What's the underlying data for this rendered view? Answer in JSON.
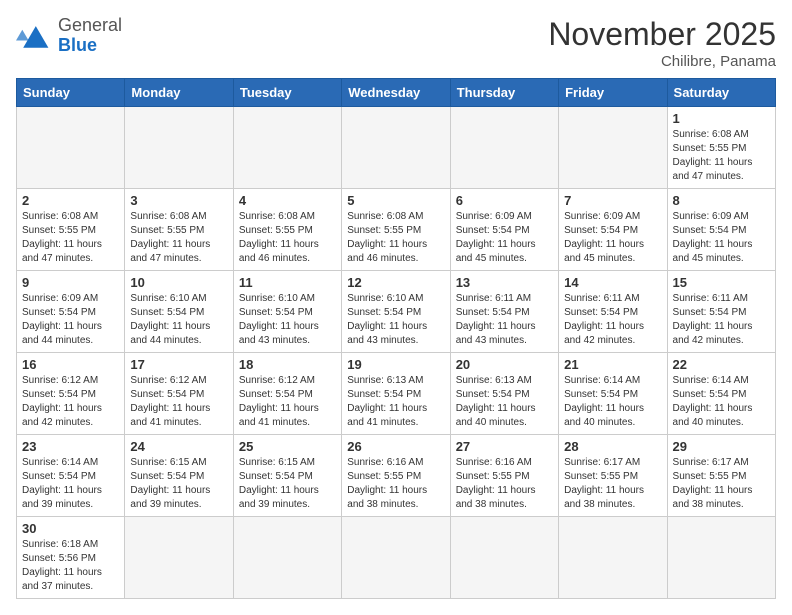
{
  "header": {
    "logo_general": "General",
    "logo_blue": "Blue",
    "month_title": "November 2025",
    "location": "Chilibre, Panama"
  },
  "weekdays": [
    "Sunday",
    "Monday",
    "Tuesday",
    "Wednesday",
    "Thursday",
    "Friday",
    "Saturday"
  ],
  "days": [
    {
      "date": null,
      "empty": true
    },
    {
      "date": null,
      "empty": true
    },
    {
      "date": null,
      "empty": true
    },
    {
      "date": null,
      "empty": true
    },
    {
      "date": null,
      "empty": true
    },
    {
      "date": null,
      "empty": true
    },
    {
      "date": "1",
      "sunrise": "6:08 AM",
      "sunset": "5:55 PM",
      "daylight": "11 hours and 47 minutes."
    },
    {
      "date": "2",
      "sunrise": "6:08 AM",
      "sunset": "5:55 PM",
      "daylight": "11 hours and 47 minutes."
    },
    {
      "date": "3",
      "sunrise": "6:08 AM",
      "sunset": "5:55 PM",
      "daylight": "11 hours and 47 minutes."
    },
    {
      "date": "4",
      "sunrise": "6:08 AM",
      "sunset": "5:55 PM",
      "daylight": "11 hours and 46 minutes."
    },
    {
      "date": "5",
      "sunrise": "6:08 AM",
      "sunset": "5:55 PM",
      "daylight": "11 hours and 46 minutes."
    },
    {
      "date": "6",
      "sunrise": "6:09 AM",
      "sunset": "5:54 PM",
      "daylight": "11 hours and 45 minutes."
    },
    {
      "date": "7",
      "sunrise": "6:09 AM",
      "sunset": "5:54 PM",
      "daylight": "11 hours and 45 minutes."
    },
    {
      "date": "8",
      "sunrise": "6:09 AM",
      "sunset": "5:54 PM",
      "daylight": "11 hours and 45 minutes."
    },
    {
      "date": "9",
      "sunrise": "6:09 AM",
      "sunset": "5:54 PM",
      "daylight": "11 hours and 44 minutes."
    },
    {
      "date": "10",
      "sunrise": "6:10 AM",
      "sunset": "5:54 PM",
      "daylight": "11 hours and 44 minutes."
    },
    {
      "date": "11",
      "sunrise": "6:10 AM",
      "sunset": "5:54 PM",
      "daylight": "11 hours and 43 minutes."
    },
    {
      "date": "12",
      "sunrise": "6:10 AM",
      "sunset": "5:54 PM",
      "daylight": "11 hours and 43 minutes."
    },
    {
      "date": "13",
      "sunrise": "6:11 AM",
      "sunset": "5:54 PM",
      "daylight": "11 hours and 43 minutes."
    },
    {
      "date": "14",
      "sunrise": "6:11 AM",
      "sunset": "5:54 PM",
      "daylight": "11 hours and 42 minutes."
    },
    {
      "date": "15",
      "sunrise": "6:11 AM",
      "sunset": "5:54 PM",
      "daylight": "11 hours and 42 minutes."
    },
    {
      "date": "16",
      "sunrise": "6:12 AM",
      "sunset": "5:54 PM",
      "daylight": "11 hours and 42 minutes."
    },
    {
      "date": "17",
      "sunrise": "6:12 AM",
      "sunset": "5:54 PM",
      "daylight": "11 hours and 41 minutes."
    },
    {
      "date": "18",
      "sunrise": "6:12 AM",
      "sunset": "5:54 PM",
      "daylight": "11 hours and 41 minutes."
    },
    {
      "date": "19",
      "sunrise": "6:13 AM",
      "sunset": "5:54 PM",
      "daylight": "11 hours and 41 minutes."
    },
    {
      "date": "20",
      "sunrise": "6:13 AM",
      "sunset": "5:54 PM",
      "daylight": "11 hours and 40 minutes."
    },
    {
      "date": "21",
      "sunrise": "6:14 AM",
      "sunset": "5:54 PM",
      "daylight": "11 hours and 40 minutes."
    },
    {
      "date": "22",
      "sunrise": "6:14 AM",
      "sunset": "5:54 PM",
      "daylight": "11 hours and 40 minutes."
    },
    {
      "date": "23",
      "sunrise": "6:14 AM",
      "sunset": "5:54 PM",
      "daylight": "11 hours and 39 minutes."
    },
    {
      "date": "24",
      "sunrise": "6:15 AM",
      "sunset": "5:54 PM",
      "daylight": "11 hours and 39 minutes."
    },
    {
      "date": "25",
      "sunrise": "6:15 AM",
      "sunset": "5:54 PM",
      "daylight": "11 hours and 39 minutes."
    },
    {
      "date": "26",
      "sunrise": "6:16 AM",
      "sunset": "5:55 PM",
      "daylight": "11 hours and 38 minutes."
    },
    {
      "date": "27",
      "sunrise": "6:16 AM",
      "sunset": "5:55 PM",
      "daylight": "11 hours and 38 minutes."
    },
    {
      "date": "28",
      "sunrise": "6:17 AM",
      "sunset": "5:55 PM",
      "daylight": "11 hours and 38 minutes."
    },
    {
      "date": "29",
      "sunrise": "6:17 AM",
      "sunset": "5:55 PM",
      "daylight": "11 hours and 38 minutes."
    },
    {
      "date": "30",
      "sunrise": "6:18 AM",
      "sunset": "5:56 PM",
      "daylight": "11 hours and 37 minutes."
    },
    {
      "date": null,
      "empty": true
    },
    {
      "date": null,
      "empty": true
    },
    {
      "date": null,
      "empty": true
    },
    {
      "date": null,
      "empty": true
    },
    {
      "date": null,
      "empty": true
    }
  ]
}
